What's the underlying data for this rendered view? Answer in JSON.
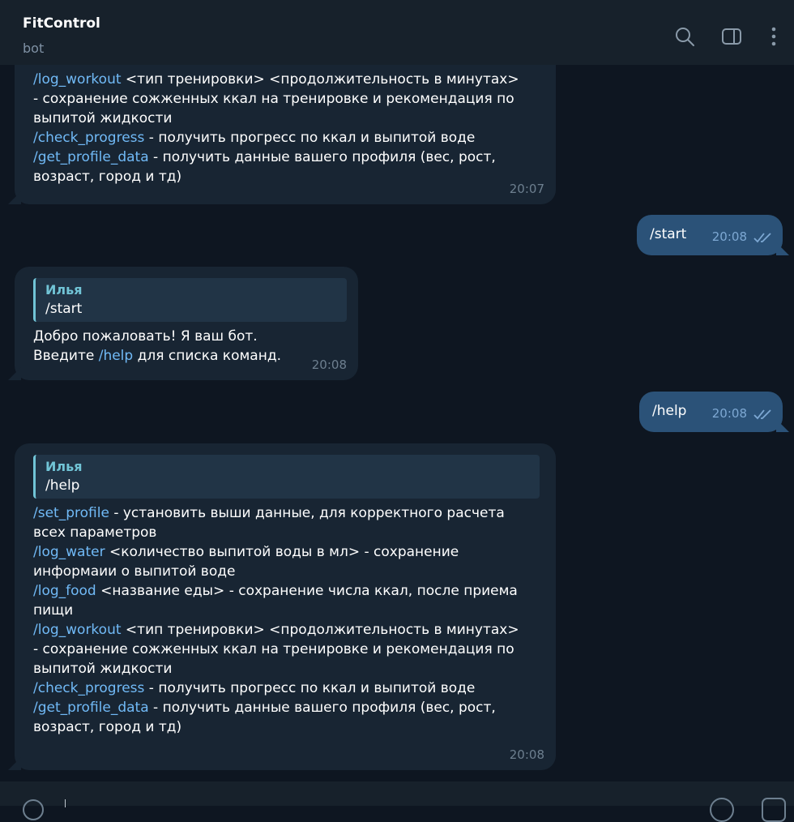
{
  "header": {
    "title": "FitControl",
    "subtitle": "bot",
    "icons": [
      "search-icon",
      "sidebar-toggle-icon",
      "more-vertical-icon"
    ]
  },
  "colors": {
    "background": "#0e1621",
    "incoming_bubble": "#182533",
    "outgoing_bubble": "#2b5278",
    "link": "#71baf7",
    "quote_accent": "#71c4d6"
  },
  "messages": {
    "m1": {
      "lines": [
        {
          "cmd": "/log_workout",
          "text": " <тип тренировки> <продолжительность в минутах>"
        },
        {
          "cmd": "",
          "text": "- сохранение сожженных ккал на тренировке и рекомендация по"
        },
        {
          "cmd": "",
          "text": "выпитой жидкости"
        },
        {
          "cmd": "/check_progress",
          "text": " - получить прогресс по ккал и выпитой воде"
        },
        {
          "cmd": "/get_profile_data",
          "text": " - получить данные вашего профиля (вес, рост,"
        },
        {
          "cmd": "",
          "text": "возраст, город и тд)"
        }
      ],
      "time": "20:07"
    },
    "m2": {
      "cmd": "/start",
      "time": "20:08"
    },
    "m3": {
      "quote_name": "Илья",
      "quote_text": "/start",
      "line1": "Добро пожаловать! Я ваш бот.",
      "line2_pre": "Введите ",
      "line2_cmd": "/help",
      "line2_post": " для списка команд.",
      "time": "20:08"
    },
    "m4": {
      "cmd": "/help",
      "time": "20:08"
    },
    "m5": {
      "quote_name": "Илья",
      "quote_text": "/help",
      "lines": [
        {
          "cmd": "/set_profile",
          "text": " - установить выши данные, для корректного расчета"
        },
        {
          "cmd": "",
          "text": "всех параметров"
        },
        {
          "cmd": "/log_water",
          "text": " <количество выпитой воды в мл> - сохранение"
        },
        {
          "cmd": "",
          "text": "информаии о выпитой воде"
        },
        {
          "cmd": "/log_food",
          "text": " <название еды> - сохранение числа ккал, после приема"
        },
        {
          "cmd": "",
          "text": "пищи"
        },
        {
          "cmd": "/log_workout",
          "text": " <тип тренировки> <продолжительность в минутах>"
        },
        {
          "cmd": "",
          "text": "- сохранение сожженных ккал на тренировке и рекомендация по"
        },
        {
          "cmd": "",
          "text": "выпитой жидкости"
        },
        {
          "cmd": "/check_progress",
          "text": " - получить прогресс по ккал и выпитой воде"
        },
        {
          "cmd": "/get_profile_data",
          "text": " - получить данные вашего профиля (вес, рост,"
        },
        {
          "cmd": "",
          "text": "возраст, город и тд)"
        }
      ],
      "time": "20:08"
    }
  }
}
